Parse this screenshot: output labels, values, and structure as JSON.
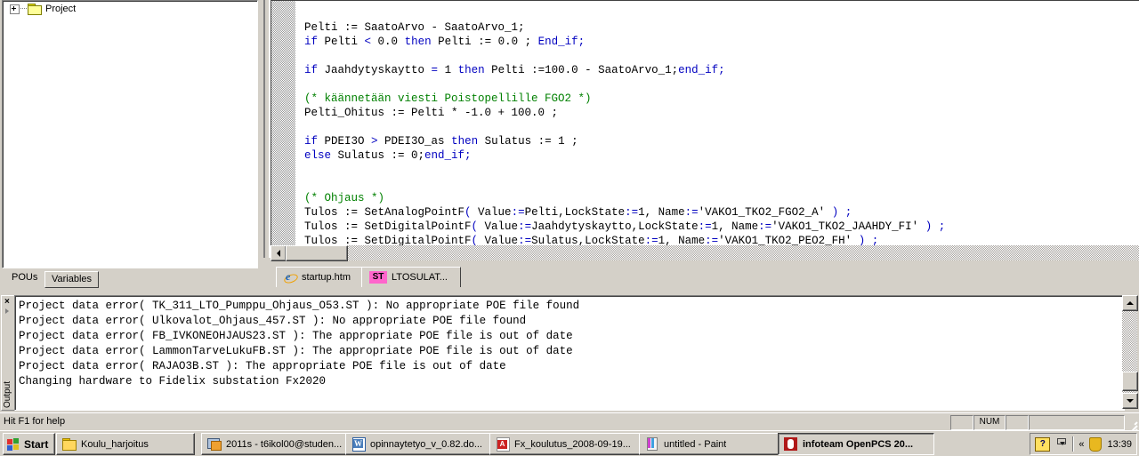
{
  "tree": {
    "root_label": "Project",
    "tabs": [
      {
        "label": "POUs",
        "selected": true
      },
      {
        "label": "Variables",
        "selected": false
      }
    ]
  },
  "editor": {
    "lines": [
      [
        {
          "t": "Pelti := SaatoArvo - SaatoArvo_1;",
          "c": "plain"
        }
      ],
      [
        {
          "t": "if",
          "c": "kw"
        },
        {
          "t": " Pelti ",
          "c": "plain"
        },
        {
          "t": "<",
          "c": "kw"
        },
        {
          "t": " 0.0 ",
          "c": "plain"
        },
        {
          "t": "then",
          "c": "kw"
        },
        {
          "t": " Pelti := 0.0 ; ",
          "c": "plain"
        },
        {
          "t": "End_if;",
          "c": "kw"
        }
      ],
      [
        {
          "t": "",
          "c": "plain"
        }
      ],
      [
        {
          "t": "if",
          "c": "kw"
        },
        {
          "t": " Jaahdytyskaytto ",
          "c": "plain"
        },
        {
          "t": "=",
          "c": "kw"
        },
        {
          "t": " 1 ",
          "c": "plain"
        },
        {
          "t": "then",
          "c": "kw"
        },
        {
          "t": " Pelti :=100.0 - SaatoArvo_1;",
          "c": "plain"
        },
        {
          "t": "end_if;",
          "c": "kw"
        }
      ],
      [
        {
          "t": "",
          "c": "plain"
        }
      ],
      [
        {
          "t": "(* käännetään viesti Poistopellille FGO2 *)",
          "c": "cm"
        }
      ],
      [
        {
          "t": "Pelti_Ohitus := Pelti * -1.0 + 100.0 ;",
          "c": "plain"
        }
      ],
      [
        {
          "t": "",
          "c": "plain"
        }
      ],
      [
        {
          "t": "if",
          "c": "kw"
        },
        {
          "t": " PDEI3O ",
          "c": "plain"
        },
        {
          "t": ">",
          "c": "kw"
        },
        {
          "t": " PDEI3O_as ",
          "c": "plain"
        },
        {
          "t": "then",
          "c": "kw"
        },
        {
          "t": " Sulatus := 1 ;",
          "c": "plain"
        }
      ],
      [
        {
          "t": "else",
          "c": "kw"
        },
        {
          "t": " Sulatus := 0;",
          "c": "plain"
        },
        {
          "t": "end_if;",
          "c": "kw"
        }
      ],
      [
        {
          "t": "",
          "c": "plain"
        }
      ],
      [
        {
          "t": "",
          "c": "plain"
        }
      ],
      [
        {
          "t": "(* Ohjaus *)",
          "c": "cm"
        }
      ],
      [
        {
          "t": "Tulos := SetAnalogPointF",
          "c": "plain"
        },
        {
          "t": "(",
          "c": "kw"
        },
        {
          "t": " Value",
          "c": "plain"
        },
        {
          "t": ":=",
          "c": "kw"
        },
        {
          "t": "Pelti,LockState",
          "c": "plain"
        },
        {
          "t": ":=",
          "c": "kw"
        },
        {
          "t": "1, Name",
          "c": "plain"
        },
        {
          "t": ":=",
          "c": "kw"
        },
        {
          "t": "'VAKO1_TKO2_FGO2_A' ",
          "c": "plain"
        },
        {
          "t": ")",
          "c": "kw"
        },
        {
          "t": " ",
          "c": "plain"
        },
        {
          "t": ";",
          "c": "kw"
        }
      ],
      [
        {
          "t": "Tulos := SetDigitalPointF",
          "c": "plain"
        },
        {
          "t": "(",
          "c": "kw"
        },
        {
          "t": " Value",
          "c": "plain"
        },
        {
          "t": ":=",
          "c": "kw"
        },
        {
          "t": "Jaahdytyskaytto,LockState",
          "c": "plain"
        },
        {
          "t": ":=",
          "c": "kw"
        },
        {
          "t": "1, Name",
          "c": "plain"
        },
        {
          "t": ":=",
          "c": "kw"
        },
        {
          "t": "'VAKO1_TKO2_JAAHDY_FI' ",
          "c": "plain"
        },
        {
          "t": ")",
          "c": "kw"
        },
        {
          "t": " ",
          "c": "plain"
        },
        {
          "t": ";",
          "c": "kw"
        }
      ],
      [
        {
          "t": "Tulos := SetDigitalPointF",
          "c": "plain"
        },
        {
          "t": "(",
          "c": "kw"
        },
        {
          "t": " Value",
          "c": "plain"
        },
        {
          "t": ":=",
          "c": "kw"
        },
        {
          "t": "Sulatus,LockState",
          "c": "plain"
        },
        {
          "t": ":=",
          "c": "kw"
        },
        {
          "t": "1, Name",
          "c": "plain"
        },
        {
          "t": ":=",
          "c": "kw"
        },
        {
          "t": "'VAKO1_TKO2_PEO2_FH' ",
          "c": "plain"
        },
        {
          "t": ")",
          "c": "kw"
        },
        {
          "t": " ",
          "c": "plain"
        },
        {
          "t": ";",
          "c": "kw"
        }
      ]
    ]
  },
  "doc_tabs": [
    {
      "label": "startup.htm",
      "icon": "internet-explorer-icon",
      "active": false
    },
    {
      "label": "LTOSULAT...",
      "icon": "st-file-icon",
      "badge": "ST",
      "active": true
    }
  ],
  "output": {
    "panel_label": "Output",
    "close_label": "×",
    "lines": [
      "Project data error( TK_311_LTO_Pumppu_Ohjaus_O53.ST ): No appropriate POE file found",
      "Project data error( Ulkovalot_Ohjaus_457.ST ): No appropriate POE file found",
      "Project data error( FB_IVKONEOHJAUS23.ST ): The appropriate POE file is out of date",
      "Project data error( LammonTarveLukuFB.ST ): The appropriate POE file is out of date",
      "Project data error( RAJAO3B.ST ): The appropriate POE file is out of date",
      "Changing hardware to Fidelix substation Fx2020"
    ]
  },
  "statusbar": {
    "hint": "Hit F1 for help",
    "indicator_num": "NUM"
  },
  "taskbar": {
    "start_label": "Start",
    "items": [
      {
        "label": "Koulu_harjoitus",
        "icon": "folder-icon",
        "active": false
      },
      {
        "label": "2011s - t6ikol00@studen...",
        "icon": "mail-icon",
        "active": false
      },
      {
        "label": "opinnaytetyo_v_0.82.do...",
        "icon": "word-document-icon",
        "active": false
      },
      {
        "label": "Fx_koulutus_2008-09-19...",
        "icon": "pdf-document-icon",
        "active": false
      },
      {
        "label": "untitled - Paint",
        "icon": "paint-icon",
        "active": false
      },
      {
        "label": "infoteam OpenPCS 20...",
        "icon": "openpcs-icon",
        "active": true
      }
    ],
    "tray": {
      "help_icon_label": "?",
      "expand_label": "«",
      "clock": "13:39"
    }
  },
  "colors": {
    "face": "#d4d0c8",
    "keyword": "#0000c0",
    "comment": "#008000",
    "st_badge": "#ff66cc",
    "selection_white": "#ffffff"
  }
}
